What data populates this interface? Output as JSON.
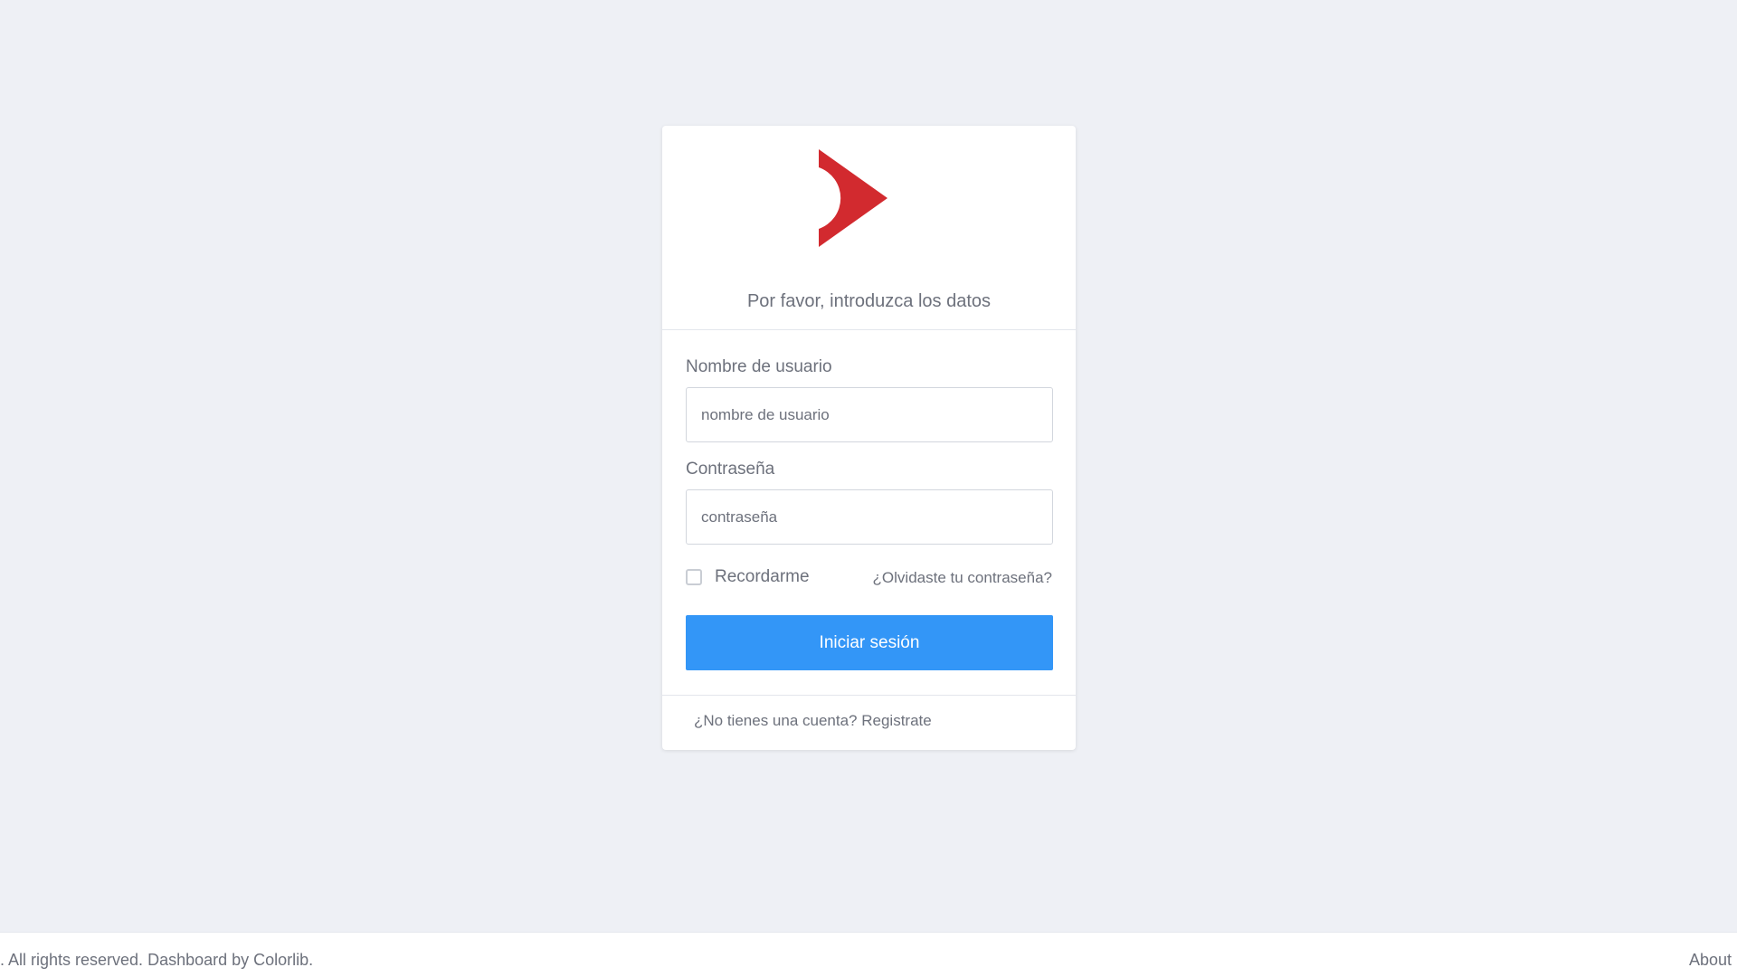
{
  "login": {
    "subtitle": "Por favor, introduzca los datos",
    "username_label": "Nombre de usuario",
    "username_placeholder": "nombre de usuario",
    "username_value": "",
    "password_label": "Contraseña",
    "password_placeholder": "contraseña",
    "password_value": "",
    "remember_label": "Recordarme",
    "remember_checked": false,
    "forgot_link": "¿Olvidaste tu contraseña?",
    "submit_label": "Iniciar sesión",
    "signup_link": "¿No tienes una cuenta? Registrate"
  },
  "logo": {
    "icon": "red-play-chevron-logo",
    "color": "#d22a2f"
  },
  "footer": {
    "copyright": ". All rights reserved. Dashboard by Colorlib.",
    "about_link": "About"
  },
  "colors": {
    "background": "#eef0f5",
    "primary_button": "#3396f7",
    "text": "#6d717c"
  }
}
